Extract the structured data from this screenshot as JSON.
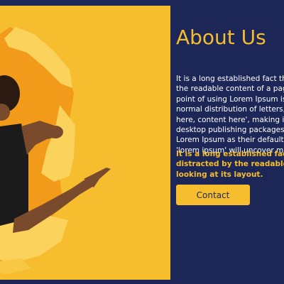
{
  "about": {
    "title": "About Us",
    "paragraph_1": "It is a long established fact that a reader will be distracted by the readable content of a page when looking at its layout. The point of using Lorem Ipsum is that it has a more-or-less normal distribution of letters, as opposed to using 'Content here, content here', making it look like readable English. Many desktop publishing packages and web page editors now use Lorem Ipsum as their default model text, and a search for 'lorem ipsum' will uncover many web sites still in their infancy.",
    "paragraph_2": "It is a long established fact that a reader will be distracted by the readable content of a page when looking at its layout.",
    "contact_label": "Contact"
  },
  "colors": {
    "background": "#1c2757",
    "accent": "#f6bd2f",
    "text": "#ffffff"
  }
}
